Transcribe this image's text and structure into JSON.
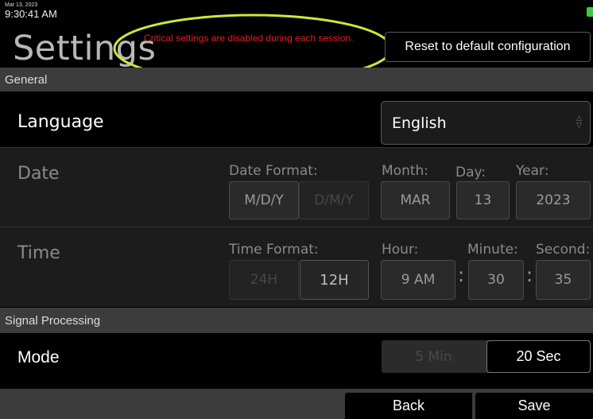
{
  "status": {
    "date": "Mar 13, 2023",
    "time": "9:30:41 AM"
  },
  "header": {
    "title": "Settings",
    "warning": "Critical settings are disabled during each session.",
    "reset_label": "Reset to default configuration"
  },
  "sections": {
    "general": "General",
    "signal_processing": "Signal Processing"
  },
  "language": {
    "label": "Language",
    "value": "English"
  },
  "date": {
    "label": "Date",
    "format_label": "Date Format:",
    "formats": [
      "M/D/Y",
      "D/M/Y"
    ],
    "selected_format": "M/D/Y",
    "month_label": "Month:",
    "month": "MAR",
    "day_label": "Day:",
    "day": "13",
    "year_label": "Year:",
    "year": "2023"
  },
  "time": {
    "label": "Time",
    "format_label": "Time Format:",
    "formats": [
      "24H",
      "12H"
    ],
    "selected_format": "12H",
    "hour_label": "Hour:",
    "hour": "9 AM",
    "minute_label": "Minute:",
    "minute": "30",
    "second_label": "Second:",
    "second": "35",
    "separator": ":"
  },
  "mode": {
    "label": "Mode",
    "options": [
      "5 Min",
      "20 Sec"
    ],
    "selected": "20 Sec"
  },
  "footer": {
    "back_label": "Back",
    "save_label": "Save"
  },
  "colors": {
    "warning": "#e02020",
    "highlight": "#c8ea3a",
    "battery": "#3ec83e"
  }
}
